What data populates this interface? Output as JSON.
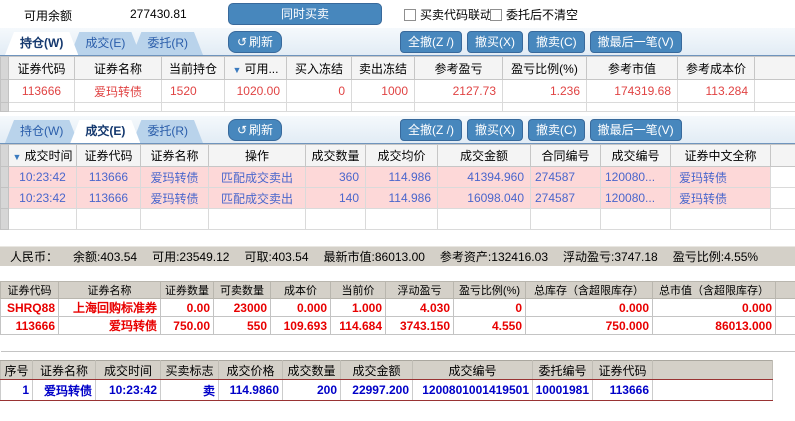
{
  "colors": {
    "accent_blue": "#4787bd",
    "tab_inactive_bg": "#b9d3eb",
    "tab_active_text": "#14386e",
    "grid_header_bg": "#f4f4f4",
    "position_row_text": "#e04343",
    "fill_row_bg": "#fdd8d8",
    "fill_row_text": "#4a66cc",
    "classic_bar_bg": "#d4d0c8",
    "holdings_text": "#e80000",
    "trade_row_text": "#0000c8",
    "trade_row_line": "#993333"
  },
  "icons": {
    "refresh": "↺",
    "sort_desc": "▼"
  },
  "top_bar": {
    "balance_label": "可用余额",
    "balance_value": "277430.81",
    "simul_button": "同时买卖",
    "checkbox1": "买卖代码联动",
    "checkbox2": "委托后不清空"
  },
  "refresh_label": "刷新",
  "action_buttons": [
    "全撤(Z /)",
    "撤买(X)",
    "撤卖(C)",
    "撤最后一笔(V)"
  ],
  "tabs1": [
    {
      "label": "持仓(W)",
      "active": true
    },
    {
      "label": "成交(E)",
      "active": false
    },
    {
      "label": "委托(R)",
      "active": false
    }
  ],
  "tabs2": [
    {
      "label": "持仓(W)",
      "active": false
    },
    {
      "label": "成交(E)",
      "active": true
    },
    {
      "label": "委托(R)",
      "active": false
    }
  ],
  "positions_table": {
    "columns": [
      "证券代码",
      "证券名称",
      "当前持仓",
      "可用...",
      "买入冻结",
      "卖出冻结",
      "参考盈亏",
      "盈亏比例(%)",
      "参考市值",
      "参考成本价"
    ],
    "sorted_column": "可用...",
    "rows": [
      [
        "113666",
        "爱玛转债",
        "1520",
        "1020.00",
        "0",
        "1000",
        "2127.73",
        "1.236",
        "174319.68",
        "113.284"
      ]
    ]
  },
  "fills_table": {
    "columns": [
      "成交时间",
      "证券代码",
      "证券名称",
      "操作",
      "成交数量",
      "成交均价",
      "成交金额",
      "合同编号",
      "成交编号",
      "证券中文全称"
    ],
    "sorted_column": "成交时间",
    "rows": [
      [
        "10:23:42",
        "113666",
        "爱玛转债",
        "匹配成交卖出",
        "360",
        "114.986",
        "41394.960",
        "274587",
        "120080...",
        "爱玛转债"
      ],
      [
        "10:23:42",
        "113666",
        "爱玛转债",
        "匹配成交卖出",
        "140",
        "114.986",
        "16098.040",
        "274587",
        "120080...",
        "爱玛转债"
      ]
    ]
  },
  "summary_bar": {
    "currency_label": "人民币：",
    "items": [
      {
        "label": "余额:",
        "value": "403.54"
      },
      {
        "label": "可用:",
        "value": "23549.12"
      },
      {
        "label": "可取:",
        "value": "403.54"
      },
      {
        "label": "最新市值:",
        "value": "86013.00"
      },
      {
        "label": "参考资产:",
        "value": "132416.03"
      },
      {
        "label": "浮动盈亏:",
        "value": "3747.18"
      },
      {
        "label": "盈亏比例:",
        "value": "4.55%"
      }
    ]
  },
  "holdings_table": {
    "columns": [
      "证券代码",
      "证券名称",
      "证券数量",
      "可卖数量",
      "成本价",
      "当前价",
      "浮动盈亏",
      "盈亏比例(%)",
      "总库存（含超限库存）",
      "总市值（含超限库存）"
    ],
    "rows": [
      [
        "SHRQ88",
        "上海回购标准券",
        "0.00",
        "23000",
        "0.000",
        "1.000",
        "4.030",
        "0",
        "0.000",
        "0.000"
      ],
      [
        "113666",
        "爱玛转债",
        "750.00",
        "550",
        "109.693",
        "114.684",
        "3743.150",
        "4.550",
        "750.000",
        "86013.000"
      ]
    ]
  },
  "today_trades_table": {
    "columns": [
      "序号",
      "证券名称",
      "成交时间",
      "买卖标志",
      "成交价格",
      "成交数量",
      "成交金额",
      "成交编号",
      "委托编号",
      "证券代码"
    ],
    "rows": [
      [
        "1",
        "爱玛转债",
        "10:23:42",
        "卖",
        "114.9860",
        "200",
        "22997.200",
        "1200801001419501",
        "10001981",
        "113666"
      ]
    ]
  }
}
